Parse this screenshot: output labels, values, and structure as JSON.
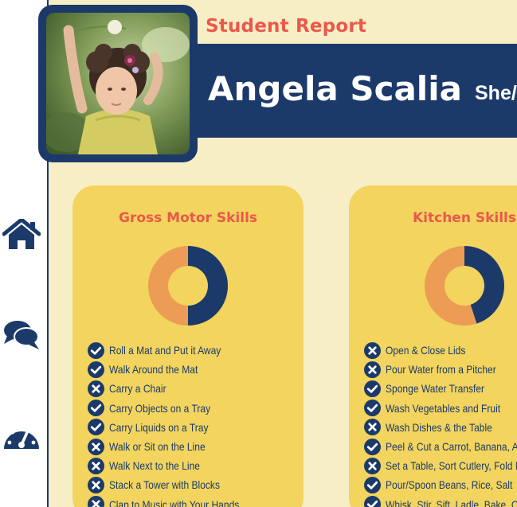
{
  "colors": {
    "navy": "#1c3a69",
    "coral": "#e9584b",
    "cream": "#f8eec5",
    "card": "#f2d45e",
    "orange": "#ec9c55"
  },
  "sidebar": {
    "items": [
      {
        "icon": "home-icon"
      },
      {
        "icon": "comments-icon"
      },
      {
        "icon": "dashboard-gauge-icon"
      }
    ]
  },
  "header": {
    "report_label": "Student Report",
    "student_name": "Angela Scalia",
    "pronouns": "She/"
  },
  "cards": [
    {
      "title": "Gross Motor Skills",
      "completed_fraction": 0.5,
      "skills": [
        {
          "label": "Roll a Mat and Put it Away",
          "status": "done"
        },
        {
          "label": "Walk Around the Mat",
          "status": "done"
        },
        {
          "label": "Carry a Chair",
          "status": "not-done"
        },
        {
          "label": "Carry Objects on a Tray",
          "status": "done"
        },
        {
          "label": "Carry Liquids on a Tray",
          "status": "done"
        },
        {
          "label": "Walk or Sit on the Line",
          "status": "not-done"
        },
        {
          "label": "Walk Next to the Line",
          "status": "not-done"
        },
        {
          "label": "Stack a Tower with Blocks",
          "status": "not-done"
        },
        {
          "label": "Clap to Music with Your Hands",
          "status": "not-done"
        }
      ]
    },
    {
      "title": "Kitchen Skills",
      "completed_fraction": 0.45,
      "skills": [
        {
          "label": "Open & Close Lids",
          "status": "not-done"
        },
        {
          "label": "Pour Water from a Pitcher",
          "status": "not-done"
        },
        {
          "label": "Sponge Water Transfer",
          "status": "done"
        },
        {
          "label": "Wash Vegetables and Fruit",
          "status": "done"
        },
        {
          "label": "Wash Dishes & the Table",
          "status": "not-done"
        },
        {
          "label": "Peel & Cut a Carrot, Banana, A",
          "status": "done"
        },
        {
          "label": "Set a Table, Sort Cutlery, Fold N",
          "status": "not-done"
        },
        {
          "label": "Pour/Spoon Beans, Rice, Salt",
          "status": "done"
        },
        {
          "label": "Whisk, Stir, Sift, Ladle, Bake, C",
          "status": "done"
        }
      ]
    }
  ]
}
